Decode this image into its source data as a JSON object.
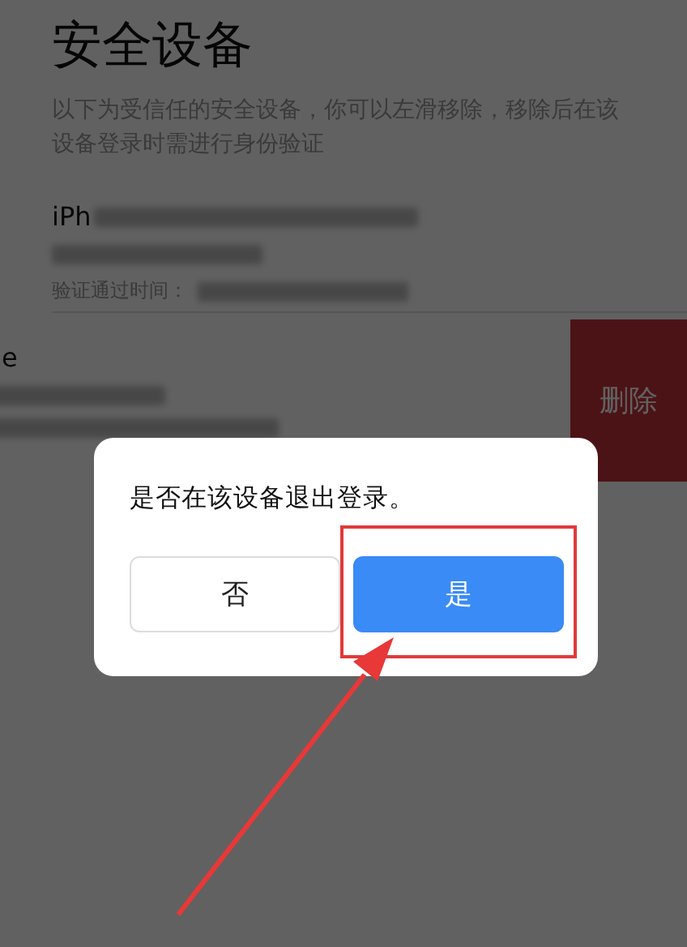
{
  "page": {
    "title": "安全设备",
    "description": "以下为受信任的安全设备，你可以左滑移除，移除后在该设备登录时需进行身份验证"
  },
  "devices": [
    {
      "name": "iPh",
      "label": "验证通过时间：",
      "swiped": false
    },
    {
      "name": "e",
      "swiped": true,
      "action": "删除"
    }
  ],
  "dialog": {
    "message": "是否在该设备退出登录。",
    "buttons": [
      {
        "label": "否",
        "kind": "secondary",
        "highlighted": false
      },
      {
        "label": "是",
        "kind": "primary",
        "highlighted": true
      }
    ]
  }
}
